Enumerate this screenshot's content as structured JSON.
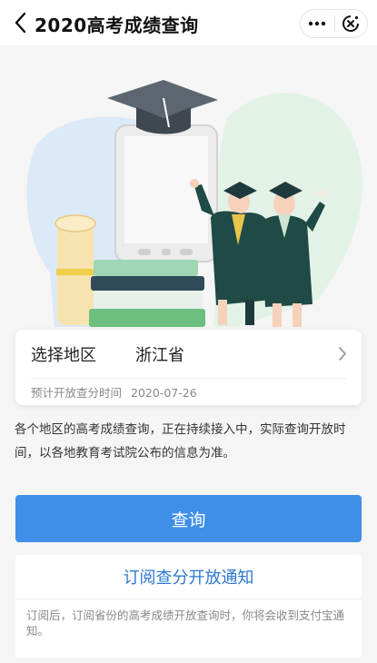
{
  "header": {
    "title": "2020高考成绩查询"
  },
  "region": {
    "label": "选择地区",
    "value": "浙江省",
    "expected_open_label": "预计开放查分时间",
    "expected_open_date": "2020-07-26"
  },
  "notice": {
    "text": "各个地区的高考成绩查询，正在持续接入中，实际查询开放时间，以各地教育考试院公布的信息为准。"
  },
  "actions": {
    "query_label": "查询",
    "subscribe_label": "订阅查分开放通知",
    "subscribe_desc": "订阅后，订阅省份的高考成绩开放查询时，你将会收到支付宝通知。"
  },
  "icons": {
    "back": "chevron-left-icon",
    "more": "more-dots-icon",
    "close": "close-circle-icon",
    "region_arrow": "chevron-right-icon"
  },
  "colors": {
    "primary": "#3f8ee8",
    "link": "#2e77d0",
    "page_bg": "#f5f5f5"
  }
}
